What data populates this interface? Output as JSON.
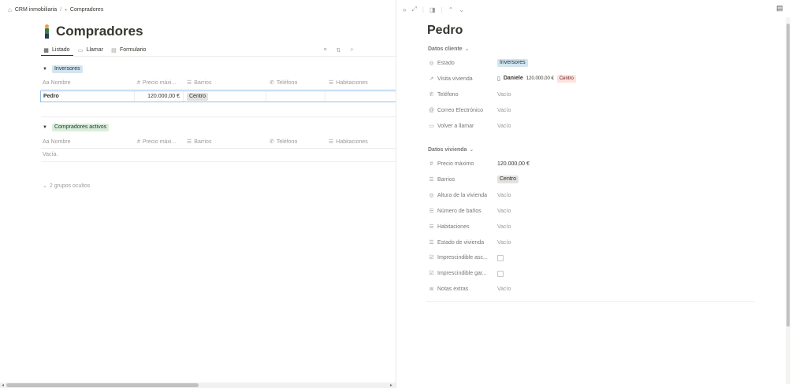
{
  "breadcrumb": {
    "workspace": "CRM inmobiliaria",
    "separator": "/",
    "page": "Compradores"
  },
  "page": {
    "title": "Compradores",
    "tabs": [
      "Listado",
      "Llamar",
      "Formulario"
    ]
  },
  "groups": [
    {
      "name": "Inversores",
      "columns": [
        "Nombre",
        "Precio máxi...",
        "Barrios",
        "Teléfono",
        "Habitaciones"
      ],
      "rows": [
        {
          "nombre": "Pedro",
          "precio": "120.000,00 €",
          "barrio": "Centro"
        }
      ]
    },
    {
      "name": "Compradores activos",
      "columns": [
        "Nombre",
        "Precio máxi...",
        "Barrios",
        "Teléfono",
        "Habitaciones"
      ],
      "empty_text": "Vacía."
    }
  ],
  "hidden_groups": "2 grupos ocultos",
  "detail": {
    "title": "Pedro",
    "section_client": "Datos cliente",
    "section_house": "Datos vivienda",
    "props_client": [
      {
        "label": "Estado",
        "value": "Inversores"
      },
      {
        "label": "Visita vivienda",
        "value": "Daniele",
        "extra_price": "120.000,00 €",
        "extra_tag": "Centro"
      },
      {
        "label": "Teléfono",
        "value": "Vacío"
      },
      {
        "label": "Correo Electrónico",
        "value": "Vacío"
      },
      {
        "label": "Volver a llamar",
        "value": "Vacío"
      }
    ],
    "props_house": [
      {
        "label": "Precio máximo",
        "value": "120.000,00 €"
      },
      {
        "label": "Barrios",
        "value": "Centro"
      },
      {
        "label": "Altura de la vivienda",
        "value": "Vacío"
      },
      {
        "label": "Número de baños",
        "value": "Vacío"
      },
      {
        "label": "Habitaciones",
        "value": "Vacío"
      },
      {
        "label": "Estado de vivienda",
        "value": "Vacío"
      },
      {
        "label": "Imprescindible asc...",
        "value": ""
      },
      {
        "label": "Imprescindible gar...",
        "value": ""
      },
      {
        "label": "Notas extras",
        "value": "Vacío"
      }
    ]
  },
  "colors": {
    "accent_blue": "#2383e2",
    "tag_blue": "#d3e5ef",
    "tag_green": "#dbeddb",
    "tag_gray": "#e3e2e0",
    "tag_red": "#ffe2dd"
  }
}
